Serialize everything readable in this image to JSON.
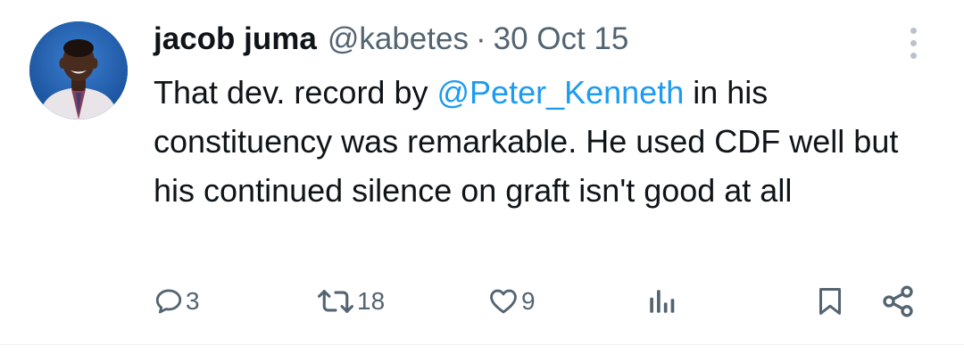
{
  "tweet": {
    "author": {
      "name": "jacob juma",
      "handle": "@kabetes",
      "avatar_icon": "profile-photo"
    },
    "separator": "·",
    "date": "30 Oct 15",
    "text": {
      "part1": "That dev. record by ",
      "mention": "@Peter_Kenneth",
      "part2": " in his constituency was remarkable. He used CDF well but his continued silence on graft isn't good at all"
    },
    "actions": {
      "reply": {
        "icon": "reply-icon",
        "count": "3"
      },
      "retweet": {
        "icon": "retweet-icon",
        "count": "18"
      },
      "like": {
        "icon": "heart-icon",
        "count": "9"
      },
      "views": {
        "icon": "views-icon"
      },
      "bookmark": {
        "icon": "bookmark-icon"
      },
      "share": {
        "icon": "share-icon"
      }
    }
  },
  "colors": {
    "text": "#0f1419",
    "secondary": "#536471",
    "link": "#1d9bf0",
    "divider": "#eff3f4"
  }
}
